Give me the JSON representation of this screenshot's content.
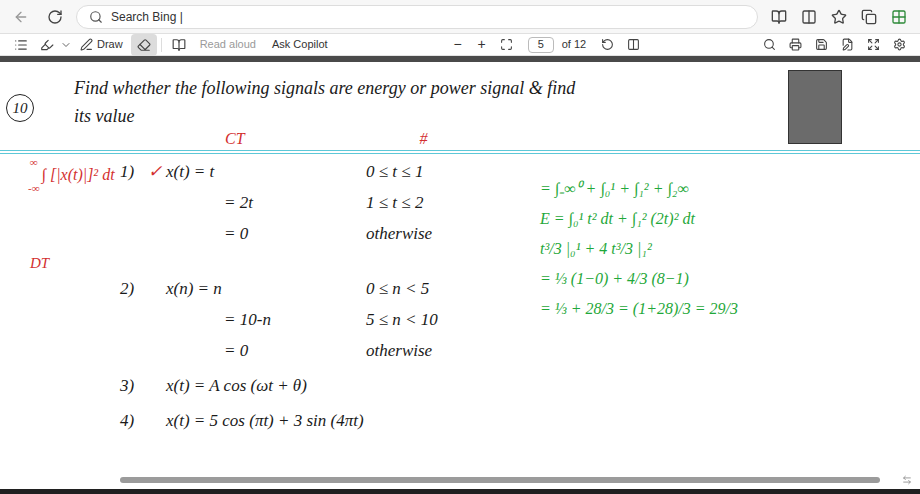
{
  "browser": {
    "address": "Search Bing |"
  },
  "pdf_toolbar": {
    "draw": "Draw",
    "eraser": {
      "selected": true
    },
    "read_aloud": {
      "label": "Read aloud",
      "disabled": true
    },
    "copilot": "Ask Copilot",
    "zoom_out": "−",
    "zoom_in": "+",
    "page": "5",
    "page_count": "of 12"
  },
  "document": {
    "margin_mark": "10",
    "heading": [
      "Find whether the following signals are energy or power signal & find",
      "its value"
    ],
    "labels": [
      {
        "text": "CT",
        "color": "#d32f2f"
      },
      {
        "text": "#",
        "color": "#d32f2f"
      }
    ],
    "note": {
      "text": "∫ [|x(t)|]² dt",
      "upper": "∞",
      "lower": "-∞",
      "color": "#d32f2f"
    },
    "problems": [
      {
        "number": "1)",
        "check": "✓",
        "label": "",
        "lines": [
          {
            "expr": "x(t)  =  t",
            "range": "0 ≤ t ≤ 1"
          },
          {
            "expr": "=  2t",
            "range": "1 ≤ t ≤ 2"
          },
          {
            "expr": "=  0",
            "range": "otherwise"
          }
        ]
      },
      {
        "number": "2)",
        "check": "",
        "label": "DT",
        "lines": [
          {
            "expr": "x(n)  =  n",
            "range": "0 ≤ n < 5"
          },
          {
            "expr": "=  10-n",
            "range": "5 ≤ n < 10"
          },
          {
            "expr": "=  0",
            "range": "otherwise"
          }
        ]
      },
      {
        "number": "3)",
        "check": "",
        "label": "",
        "lines": [
          {
            "expr": "x(t)  =  A cos (ωt + θ)",
            "range": ""
          }
        ]
      },
      {
        "number": "4)",
        "check": "",
        "label": "",
        "lines": [
          {
            "expr": "x(t)  =  5 cos (πt)  +  3 sin (4πt)",
            "range": ""
          }
        ]
      }
    ],
    "work": {
      "color": "#1fa83a",
      "lines": [
        "= ∫₋∞⁰ + ∫₀¹ + ∫₁² + ∫₂∞",
        "E = ∫₀¹ t² dt + ∫₁² (2t)² dt",
        "t³/3 |₀¹ + 4 t³/3 |₁²",
        "= ⅓ (1−0) + 4/3 (8−1)",
        "= ⅓ + 28/3 = (1+28)/3 = 29/3"
      ]
    }
  }
}
